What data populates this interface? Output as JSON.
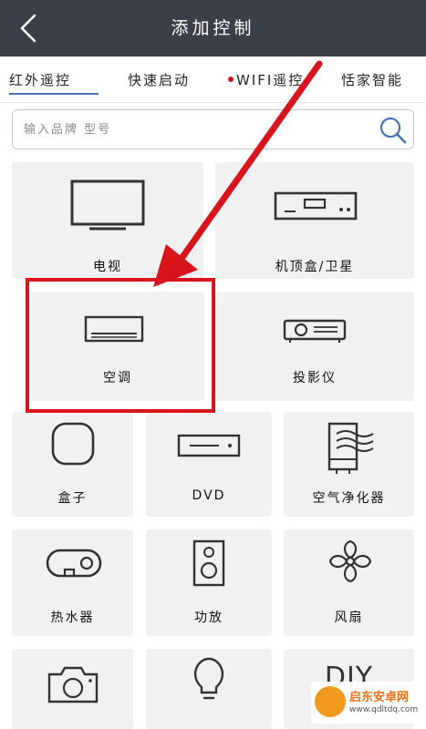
{
  "header": {
    "title": "添加控制",
    "back_icon": "chevron-left-icon"
  },
  "tabs": [
    {
      "label": "红外遥控",
      "active": true
    },
    {
      "label": "快速启动",
      "active": false
    },
    {
      "label": "WIFI遥控",
      "active": false,
      "has_dot": true
    },
    {
      "label": "恬家智能",
      "active": false
    }
  ],
  "search": {
    "placeholder": "输入品牌 型号",
    "icon": "search-icon"
  },
  "devices": [
    {
      "label": "电视",
      "icon": "tv-icon"
    },
    {
      "label": "机顶盒/卫星",
      "icon": "set-top-box-icon"
    },
    {
      "label": "空调",
      "icon": "air-conditioner-icon"
    },
    {
      "label": "投影仪",
      "icon": "projector-icon"
    },
    {
      "label": "盒子",
      "icon": "box-icon"
    },
    {
      "label": "DVD",
      "icon": "dvd-player-icon"
    },
    {
      "label": "空气净化器",
      "icon": "air-purifier-icon"
    },
    {
      "label": "热水器",
      "icon": "water-heater-icon"
    },
    {
      "label": "功放",
      "icon": "speaker-icon"
    },
    {
      "label": "风扇",
      "icon": "fan-icon"
    },
    {
      "label": "",
      "icon": "camera-icon"
    },
    {
      "label": "",
      "icon": "light-bulb-icon"
    },
    {
      "label": "DIY",
      "icon": "diy-icon"
    }
  ],
  "annotation": {
    "highlight_color": "#d9141c"
  },
  "watermark": {
    "title": "启东安卓网",
    "url": "www.qdltdq.com"
  },
  "colors": {
    "header_bg": "#3b3f47",
    "tab_underline": "#4a72b8",
    "tile_bg": "#f1f1f1",
    "accent_red": "#d9141c"
  }
}
